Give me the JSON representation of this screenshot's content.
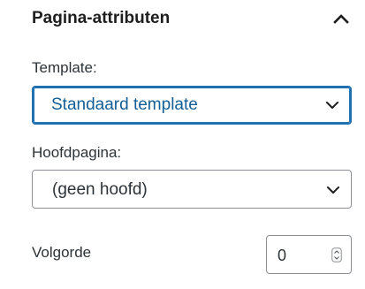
{
  "panel": {
    "title": "Pagina-attributen",
    "toggle_icon": "chevron-up-icon"
  },
  "template": {
    "label": "Template:",
    "selected": "Standaard template",
    "icon": "chevron-down-icon",
    "accent_color": "#2271b1"
  },
  "parent": {
    "label": "Hoofdpagina:",
    "selected": "(geen hoofd)",
    "icon": "chevron-down-icon"
  },
  "order": {
    "label": "Volgorde",
    "value": "0",
    "icon": "spinner-arrows-icon"
  }
}
